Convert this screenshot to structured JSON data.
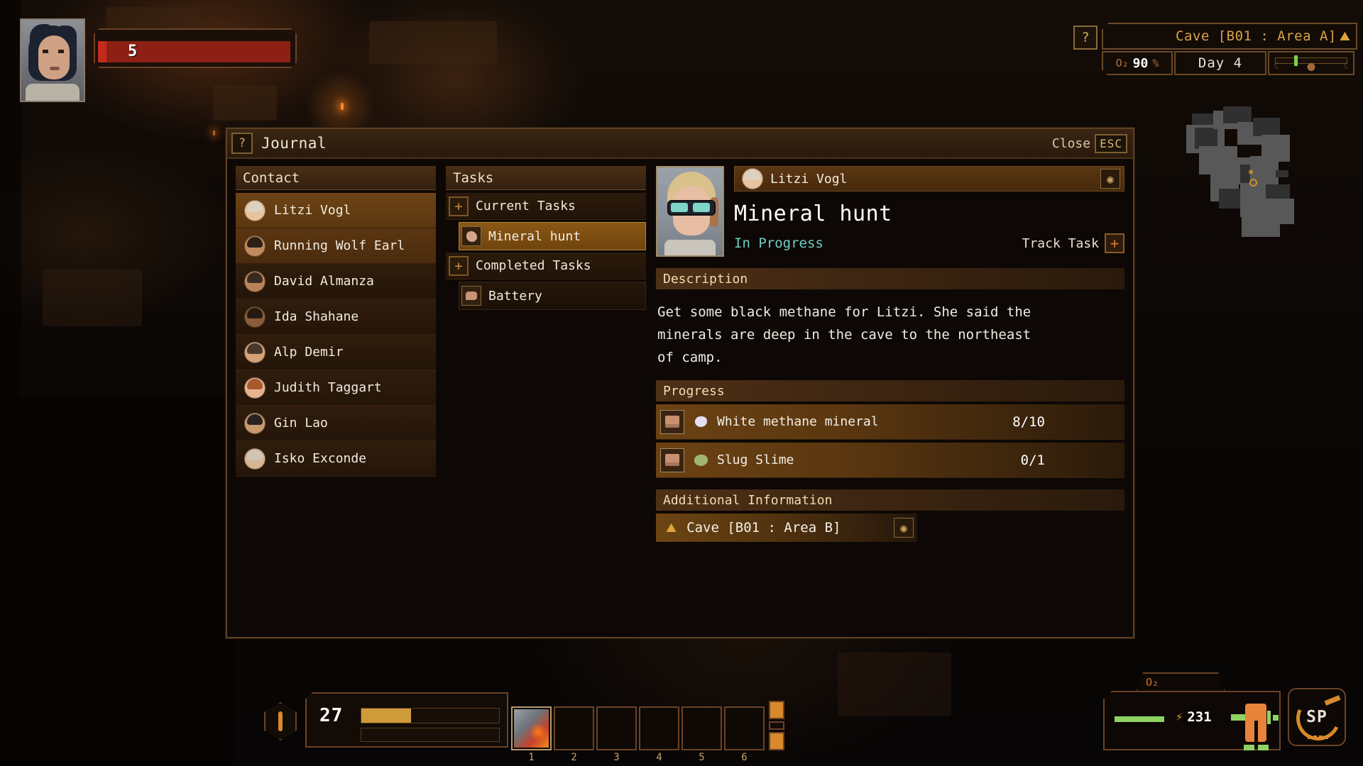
{
  "hud": {
    "health": {
      "value": "5"
    },
    "help_icon": "question-mark-icon",
    "location": {
      "text": "Cave [B01 : Area A]",
      "icon": "pickaxe-icon"
    },
    "oxygen": {
      "label": "O₂",
      "value": "90",
      "unit": "%"
    },
    "day": {
      "text": "Day 4"
    },
    "xp": {
      "value": "27"
    },
    "hotbar": {
      "slots": [
        "1",
        "2",
        "3",
        "4",
        "5",
        "6"
      ]
    },
    "suit": {
      "o2_label": "O₂",
      "power_value": "231",
      "power_icon": "lightning-icon",
      "weapon_icon": "sword-icon"
    },
    "speed_dial": {
      "text": "SP"
    }
  },
  "journal": {
    "titlebar": {
      "help_icon": "question-mark-icon",
      "title": "Journal",
      "close_label": "Close",
      "close_key": "ESC"
    },
    "contacts": {
      "header": "Contact",
      "items": [
        {
          "name": "Litzi Vogl",
          "skin": "#e8c39d",
          "hair": "#ddd2c0",
          "state": "selected"
        },
        {
          "name": "Running Wolf Earl",
          "skin": "#c08a5e",
          "hair": "#2b1f18",
          "state": "highlight"
        },
        {
          "name": "David Almanza",
          "skin": "#b8835a",
          "hair": "#3a2a20",
          "state": "normal"
        },
        {
          "name": "Ida Shahane",
          "skin": "#8a5c3a",
          "hair": "#241812",
          "state": "normal"
        },
        {
          "name": "Alp Demir",
          "skin": "#d5a276",
          "hair": "#4a382c",
          "state": "normal"
        },
        {
          "name": "Judith Taggart",
          "skin": "#e8b490",
          "hair": "#a85a2e",
          "state": "normal"
        },
        {
          "name": "Gin Lao",
          "skin": "#c79a6e",
          "hair": "#2a2220",
          "state": "normal"
        },
        {
          "name": "Isko Exconde",
          "skin": "#d9b592",
          "hair": "#cfc6b8",
          "state": "normal"
        }
      ]
    },
    "tasks": {
      "header": "Tasks",
      "groups": [
        {
          "label": "Current Tasks",
          "expand_icon": "plus-icon"
        },
        {
          "label": "Completed Tasks",
          "expand_icon": "plus-icon"
        }
      ],
      "current": [
        {
          "label": "Mineral hunt",
          "icon": "rock-icon",
          "state": "selected"
        }
      ],
      "completed": [
        {
          "label": "Battery",
          "icon": "dialogue-bubble-icon",
          "state": "normal"
        }
      ]
    },
    "detail": {
      "giver": {
        "name": "Litzi Vogl",
        "target_icon": "target-icon"
      },
      "title": "Mineral hunt",
      "status": "In Progress",
      "status_color": "#6ecfc8",
      "track_label": "Track Task",
      "track_icon": "plus-icon",
      "description_header": "Description",
      "description": "Get some black methane for Litzi. She said the minerals are deep in the cave to the northeast of camp.",
      "progress_header": "Progress",
      "progress": [
        {
          "name": "White methane mineral",
          "count": "8/10",
          "slot_icon": "box-icon",
          "item_icon": "white-mineral-icon"
        },
        {
          "name": "Slug Slime",
          "count": "0/1",
          "slot_icon": "box-icon",
          "item_icon": "slime-icon"
        }
      ],
      "additional_header": "Additional Information",
      "additional": [
        {
          "name": "Cave [B01 : Area B]",
          "icon": "pickaxe-icon",
          "target_icon": "target-icon"
        }
      ]
    }
  }
}
